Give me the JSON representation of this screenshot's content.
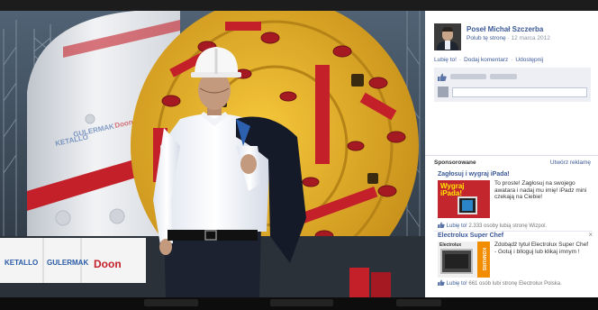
{
  "post": {
    "author_name": "Poseł Michał Szczerba",
    "like_page": "Polub tę stronę",
    "separator": "·",
    "date": "12 marca 2012",
    "actions": {
      "like": "Lubię to!",
      "comment": "Dodaj komentarz",
      "share": "Udostępnij"
    }
  },
  "sponsored": {
    "heading": "Sponsorowane",
    "create_ad": "Utwórz reklamę"
  },
  "ads": [
    {
      "title": "Zagłosuj i wygraj iPada!",
      "image_text": "Wygraj iPada!",
      "body": "To proste! Zagłosuj na swojego awatara i nadaj mu imię! iPadz mini czekają na Ciebie!",
      "like": "Lubię to!",
      "like_stat": "2.333 osoby lubią stronę Wizpol.",
      "colors": {
        "image_bg": "#c4262e",
        "image_text": "#ffe600"
      }
    },
    {
      "title": "Electrolux Super Chef",
      "close": "×",
      "image_brand": "Electrolux",
      "image_side": "KONKURS",
      "body": "Zdobądź tytuł Electrolux Super Chef - Gotuj i blloguj lub klikaj imnym !",
      "like": "Lubię to!",
      "like_stat": "661 osób lubi stronę Electrolux Polska.",
      "colors": {
        "image_bg": "#efefef",
        "image_side": "#f28c00"
      }
    }
  ],
  "photo": {
    "signs": {
      "sign_1": "KETALLO",
      "sign_2": "GULERMAK",
      "sign_3": "Doon"
    },
    "colors": {
      "tbm_yellow": "#e8b51e",
      "tbm_red": "#c4202a",
      "shield_white": "#e6e8ec"
    }
  },
  "icons": {
    "like": "thumbs-up-icon",
    "close": "close-icon"
  }
}
